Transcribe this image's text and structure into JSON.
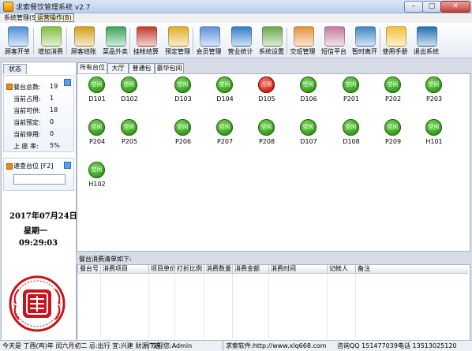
{
  "window": {
    "title": "求索餐饮管理系统 v2.7",
    "min": "–",
    "max": "□",
    "close": "✕"
  },
  "menu": {
    "system": "系统管理(S)",
    "ops": "运营操作(B)"
  },
  "toolbar": [
    {
      "label": "顾客开单",
      "icon": "order-icon",
      "color": "#4a90d9"
    },
    {
      "label": "增加消费",
      "icon": "add-consumption-icon",
      "color": "#7fbf3f"
    },
    {
      "label": "顾客结账",
      "icon": "checkout-icon",
      "color": "#d4a017"
    },
    {
      "label": "菜品外卖",
      "icon": "takeout-icon",
      "color": "#3aa35a"
    },
    {
      "label": "挂帐结算",
      "icon": "credit-settle-icon",
      "color": "#c0392b"
    },
    {
      "label": "预定管理",
      "icon": "reservation-icon",
      "color": "#e0b020"
    },
    {
      "label": "会员管理",
      "icon": "member-icon",
      "color": "#5d8fd8"
    },
    {
      "label": "营业统计",
      "icon": "statistics-icon",
      "color": "#2e7dc9"
    },
    {
      "label": "系统设置",
      "icon": "settings-icon",
      "color": "#6aa84f"
    },
    {
      "label": "交班管理",
      "icon": "shift-icon",
      "color": "#e69138"
    },
    {
      "label": "短信平台",
      "icon": "sms-icon",
      "color": "#c27ba0"
    },
    {
      "label": "暂时离开",
      "icon": "away-icon",
      "color": "#3d85c6"
    },
    {
      "label": "使用手册",
      "icon": "help-icon",
      "color": "#f1c232"
    },
    {
      "label": "退出系统",
      "icon": "exit-icon",
      "color": "#1f6fb5"
    }
  ],
  "status_panel": {
    "tab": "状态",
    "stats": [
      {
        "label": "餐台总数:",
        "value": "19"
      },
      {
        "label": "当前占用:",
        "value": "1"
      },
      {
        "label": "当前可供:",
        "value": "18"
      },
      {
        "label": "当前预定:",
        "value": "0"
      },
      {
        "label": "当前停用:",
        "value": "0"
      },
      {
        "label": "上 座 率:",
        "value": "5%"
      }
    ],
    "search_label": "速查台位 [F2]",
    "search_value": "",
    "date": "2017年07月24日",
    "weekday": "星期一",
    "time": "09:29:03"
  },
  "room_tabs": [
    "所有台位",
    "大厅",
    "普通包间",
    "豪华包间"
  ],
  "seat_free_label": "空闲",
  "seat_busy_label": "占用",
  "seats": [
    {
      "code": "D101",
      "state": "free"
    },
    {
      "code": "D102",
      "state": "free"
    },
    {
      "code": "D103",
      "state": "free"
    },
    {
      "code": "D104",
      "state": "free"
    },
    {
      "code": "D105",
      "state": "busy"
    },
    {
      "code": "D106",
      "state": "free"
    },
    {
      "code": "P201",
      "state": "free"
    },
    {
      "code": "P202",
      "state": "free"
    },
    {
      "code": "P203",
      "state": "free"
    },
    {
      "code": "P204",
      "state": "free"
    },
    {
      "code": "P205",
      "state": "free"
    },
    {
      "code": "P206",
      "state": "free"
    },
    {
      "code": "P207",
      "state": "free"
    },
    {
      "code": "P208",
      "state": "free"
    },
    {
      "code": "D107",
      "state": "free"
    },
    {
      "code": "D108",
      "state": "free"
    },
    {
      "code": "P209",
      "state": "free"
    },
    {
      "code": "H101",
      "state": "free"
    },
    {
      "code": "H102",
      "state": "free"
    }
  ],
  "bill_list": {
    "title": "餐台消费清单如下:",
    "columns": [
      "餐台号",
      "消费项目",
      "项目单价",
      "打折比例",
      "消费数量",
      "消费金额",
      "消费时间",
      "记帐人",
      "备注"
    ]
  },
  "statusbar": {
    "almanac": "今天是 丁酉(鸡)年 闰六月初二 忌:出行 宜:兴建 财源广进",
    "welcome": "欢迎您:Admin",
    "site": "求索软件:http://www.xlq668.com",
    "qq": "咨询QQ 151477039",
    "phone": "电话 13513025120"
  }
}
